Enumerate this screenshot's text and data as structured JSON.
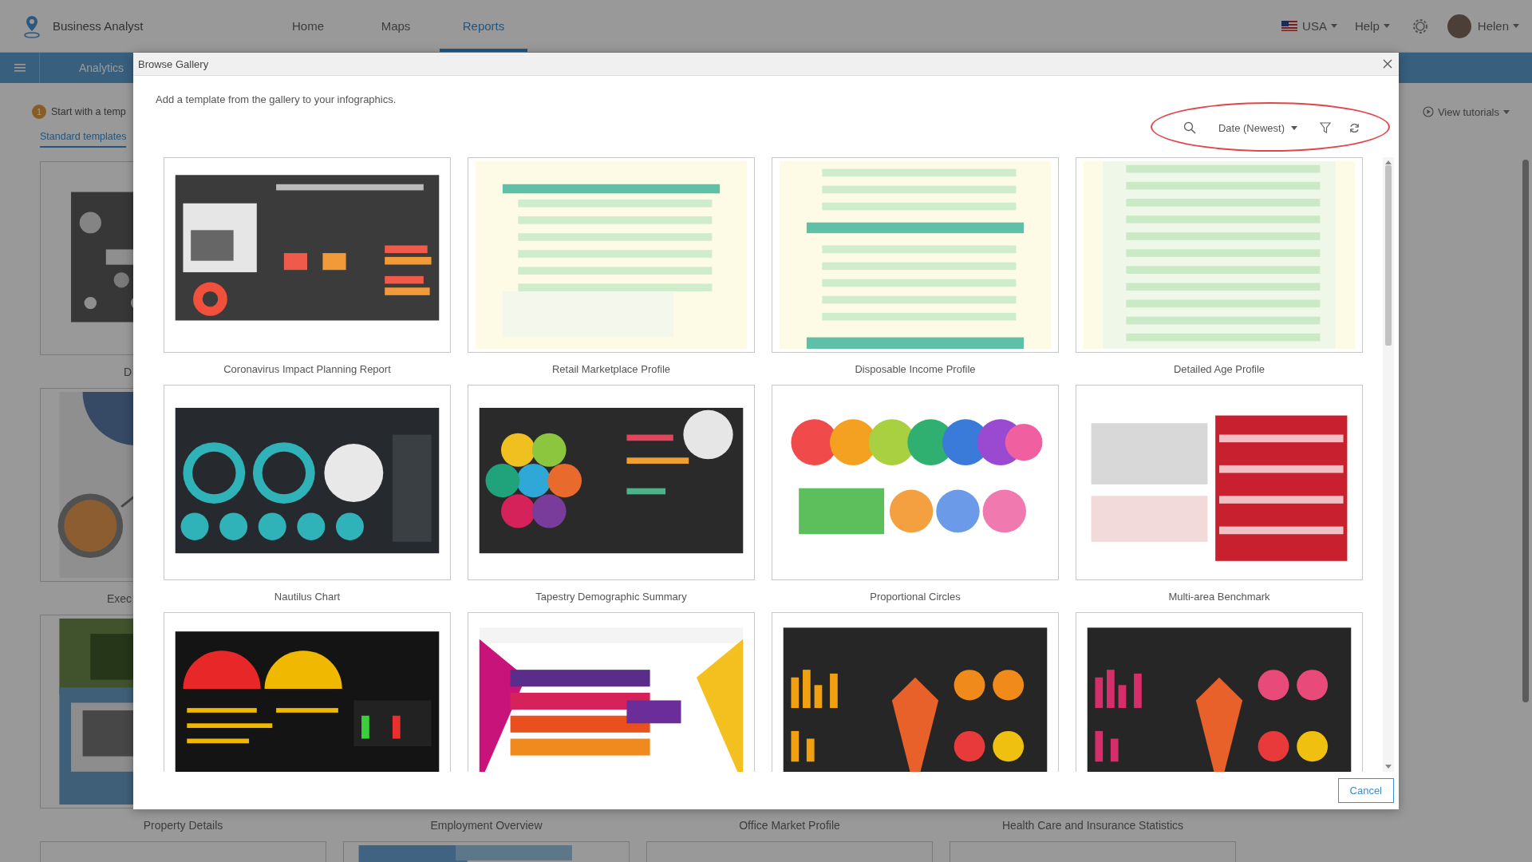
{
  "app": {
    "name": "Business Analyst",
    "nav": [
      {
        "label": "Home",
        "selected": false
      },
      {
        "label": "Maps",
        "selected": false
      },
      {
        "label": "Reports",
        "selected": true
      }
    ],
    "country": "USA",
    "help": "Help",
    "user": "Helen"
  },
  "subbar": {
    "tab": "Analytics"
  },
  "page": {
    "step_number": "1",
    "step_text": "Start with a temp",
    "tab": "Standard templates",
    "tutorials": "View tutorials",
    "left_templates": [
      {
        "name": "D",
        "kind": "picture"
      },
      {
        "name": "Exec",
        "kind": "picture"
      }
    ],
    "templates_row": [
      {
        "name": "Property Details",
        "kind": "picture"
      },
      {
        "name": "Employment Overview"
      },
      {
        "name": "Office Market Profile"
      },
      {
        "name": "Health Care and Insurance Statistics"
      }
    ],
    "next_row": [
      {
        "kind": "blank"
      },
      {
        "kind": "picture"
      },
      {
        "kind": "blank"
      },
      {
        "kind": "blank"
      }
    ]
  },
  "dialog": {
    "title": "Browse Gallery",
    "description": "Add a template from the gallery to your infographics.",
    "sort": "Date (Newest)",
    "templates": [
      {
        "name": "Coronavirus Impact Planning Report",
        "kind": "picture"
      },
      {
        "name": "Retail Marketplace Profile",
        "kind": "picture"
      },
      {
        "name": "Disposable Income Profile",
        "kind": "picture"
      },
      {
        "name": "Detailed Age Profile",
        "kind": "picture"
      },
      {
        "name": "Nautilus Chart",
        "kind": "picture"
      },
      {
        "name": "Tapestry Demographic Summary",
        "kind": "picture"
      },
      {
        "name": "Proportional Circles",
        "kind": "picture"
      },
      {
        "name": "Multi-area Benchmark",
        "kind": "picture"
      },
      {
        "kind": "picture"
      },
      {
        "kind": "picture"
      },
      {
        "kind": "picture"
      },
      {
        "kind": "picture"
      }
    ],
    "cancel": "Cancel"
  }
}
